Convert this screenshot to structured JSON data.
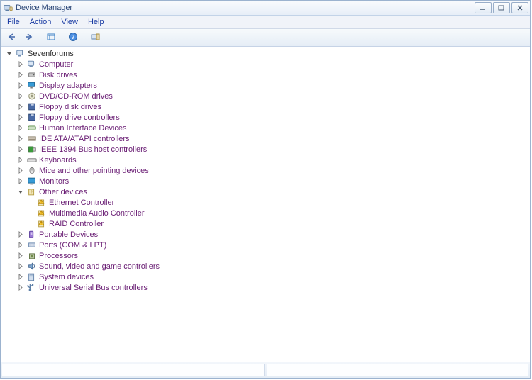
{
  "window": {
    "title": "Device Manager"
  },
  "menubar": {
    "items": [
      {
        "label": "File",
        "name": "menu-file"
      },
      {
        "label": "Action",
        "name": "menu-action"
      },
      {
        "label": "View",
        "name": "menu-view"
      },
      {
        "label": "Help",
        "name": "menu-help"
      }
    ]
  },
  "toolbar": {
    "buttons": [
      {
        "name": "back-button",
        "icon": "arrow-left-icon"
      },
      {
        "name": "forward-button",
        "icon": "arrow-right-icon"
      },
      {
        "name": "sep1",
        "icon": "sep"
      },
      {
        "name": "view-button",
        "icon": "view-icon"
      },
      {
        "name": "sep2",
        "icon": "sep"
      },
      {
        "name": "help-button",
        "icon": "help-icon"
      },
      {
        "name": "sep3",
        "icon": "sep"
      },
      {
        "name": "scan-button",
        "icon": "scan-icon"
      }
    ]
  },
  "tree": {
    "root": {
      "label": "Sevenforums",
      "icon": "computer",
      "expanded": true,
      "children": [
        {
          "label": "Computer",
          "icon": "computer",
          "expandable": true
        },
        {
          "label": "Disk drives",
          "icon": "disk",
          "expandable": true
        },
        {
          "label": "Display adapters",
          "icon": "display",
          "expandable": true
        },
        {
          "label": "DVD/CD-ROM drives",
          "icon": "dvd",
          "expandable": true
        },
        {
          "label": "Floppy disk drives",
          "icon": "floppy",
          "expandable": true
        },
        {
          "label": "Floppy drive controllers",
          "icon": "floppy",
          "expandable": true
        },
        {
          "label": "Human Interface Devices",
          "icon": "hid",
          "expandable": true
        },
        {
          "label": "IDE ATA/ATAPI controllers",
          "icon": "ide",
          "expandable": true
        },
        {
          "label": "IEEE 1394 Bus host controllers",
          "icon": "ieee",
          "expandable": true
        },
        {
          "label": "Keyboards",
          "icon": "keyboard",
          "expandable": true
        },
        {
          "label": "Mice and other pointing devices",
          "icon": "mouse",
          "expandable": true
        },
        {
          "label": "Monitors",
          "icon": "monitor",
          "expandable": true
        },
        {
          "label": "Other devices",
          "icon": "other",
          "expandable": true,
          "expanded": true,
          "children": [
            {
              "label": "Ethernet Controller",
              "icon": "warn"
            },
            {
              "label": "Multimedia Audio Controller",
              "icon": "warn"
            },
            {
              "label": "RAID Controller",
              "icon": "warn"
            }
          ]
        },
        {
          "label": "Portable Devices",
          "icon": "portable",
          "expandable": true
        },
        {
          "label": "Ports (COM & LPT)",
          "icon": "port",
          "expandable": true
        },
        {
          "label": "Processors",
          "icon": "cpu",
          "expandable": true
        },
        {
          "label": "Sound, video and game controllers",
          "icon": "sound",
          "expandable": true
        },
        {
          "label": "System devices",
          "icon": "system",
          "expandable": true
        },
        {
          "label": "Universal Serial Bus controllers",
          "icon": "usb",
          "expandable": true
        }
      ]
    }
  }
}
